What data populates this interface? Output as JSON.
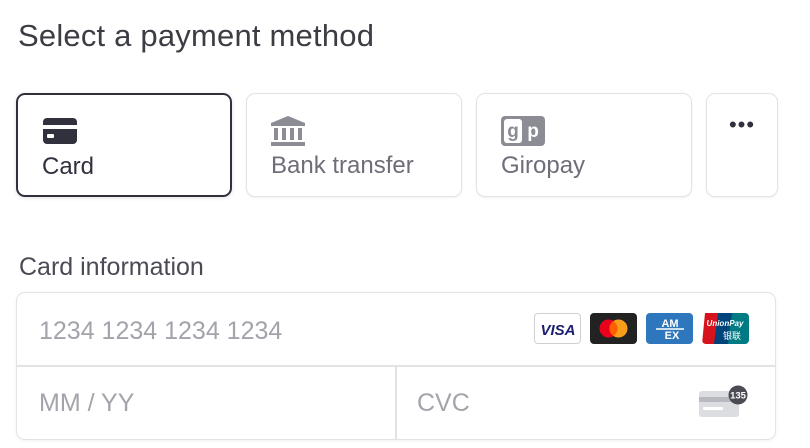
{
  "page": {
    "heading": "Select a payment method"
  },
  "payment_methods": [
    {
      "label": "Card",
      "icon": "credit-card-icon",
      "selected": true
    },
    {
      "label": "Bank transfer",
      "icon": "bank-icon",
      "selected": false
    },
    {
      "label": "Giropay",
      "icon": "giropay-icon",
      "selected": false
    }
  ],
  "more_button": {
    "label": "•••"
  },
  "card_section": {
    "label": "Card information",
    "number_placeholder": "1234 1234 1234 1234",
    "expiry_placeholder": "MM / YY",
    "cvc_placeholder": "CVC",
    "cvc_badge": "135",
    "brands": [
      {
        "name": "visa-logo",
        "text": "VISA",
        "color": "#1a1f71"
      },
      {
        "name": "mastercard-logo",
        "color": "#eb001b"
      },
      {
        "name": "amex-logo",
        "text": "AM EX",
        "color": "#2e77bc"
      },
      {
        "name": "unionpay-logo",
        "text": "UnionPay 银联",
        "color": "#d6131d"
      }
    ]
  },
  "colors": {
    "text_primary": "#30313d",
    "text_muted": "#6d6e78",
    "border": "#e3e3e6",
    "placeholder": "#a3a4ab"
  }
}
